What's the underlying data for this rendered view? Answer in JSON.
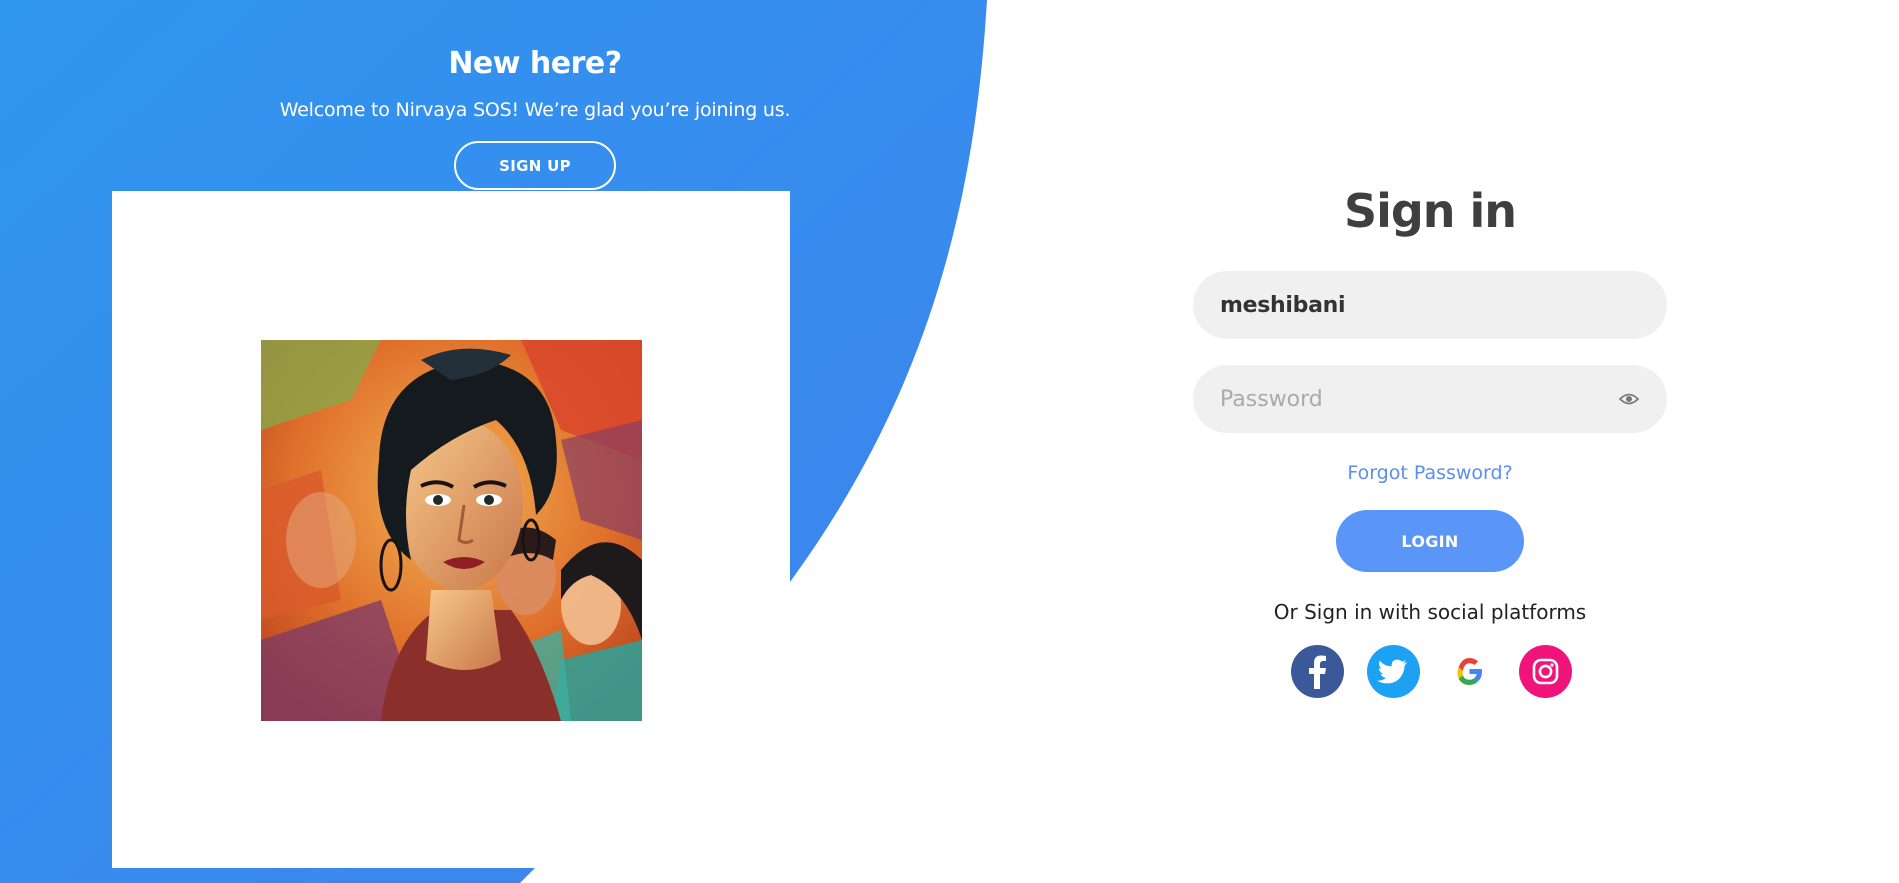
{
  "left_panel": {
    "title": "New here?",
    "text": "Welcome to Nirvaya SOS! We’re glad you’re joining us.",
    "signup_label": "SIGN UP"
  },
  "signin": {
    "title": "Sign in",
    "username_value": "meshibani",
    "password_placeholder": "Password",
    "forgot_label": "Forgot Password?",
    "login_label": "LOGIN",
    "social_text": "Or Sign in with social platforms"
  },
  "social": [
    {
      "name": "facebook",
      "icon": "facebook-icon",
      "color": "#3b5998"
    },
    {
      "name": "twitter",
      "icon": "twitter-icon",
      "color": "#1da1f2"
    },
    {
      "name": "google",
      "icon": "google-icon",
      "color": "#ffffff"
    },
    {
      "name": "instagram",
      "icon": "instagram-icon",
      "color": "#f0147a"
    }
  ],
  "colors": {
    "accent_blue": "#3a8cf0",
    "login_button": "#5996f7",
    "link": "#5b8ef0",
    "input_bg": "#f0f0f0",
    "title": "#3f3f3f"
  }
}
